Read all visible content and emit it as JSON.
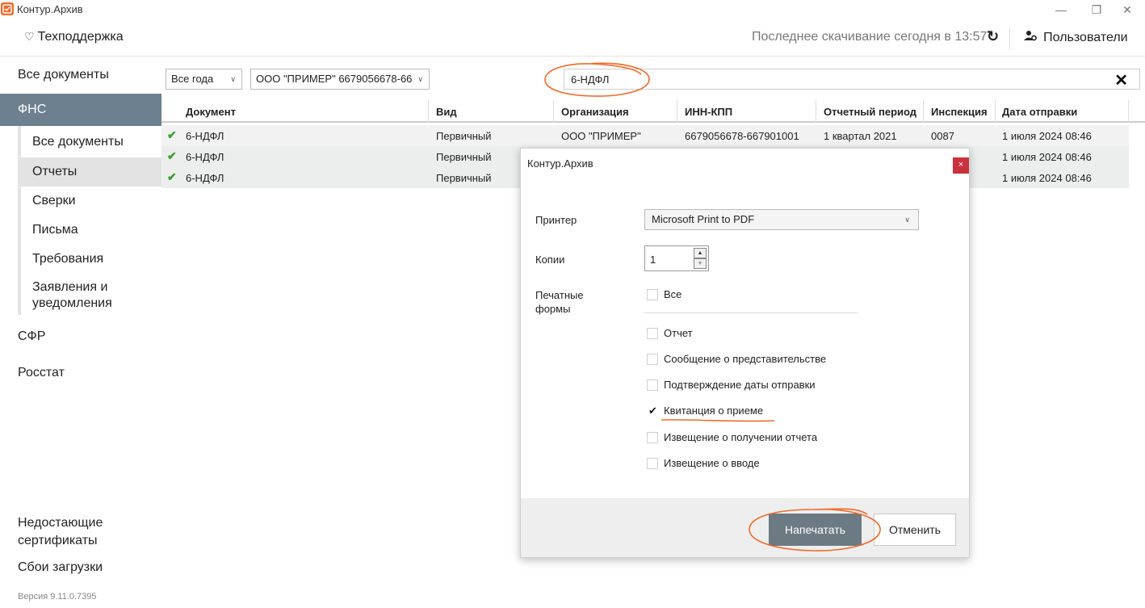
{
  "window": {
    "title": "Контур.Архив",
    "minimize_glyph": "—",
    "restore_glyph": "❐",
    "close_glyph": "✕"
  },
  "header": {
    "support_label": "Техподдержка",
    "last_download": "Последнее скачивание сегодня в 13:57",
    "users_label": "Пользователи"
  },
  "sidebar": {
    "all_documents": "Все документы",
    "fns": "ФНС",
    "fns_items": [
      "Все документы",
      "Отчеты",
      "Сверки",
      "Письма",
      "Требования",
      "Заявления и уведомления"
    ],
    "selected_item": "Отчеты",
    "sfr": "СФР",
    "rosstat": "Росстат",
    "missing_certs": "Недостающие сертификаты",
    "load_errors": "Сбои загрузки",
    "version": "Версия 9.11.0.7395"
  },
  "filters": {
    "year": "Все года",
    "organization": "ООО \"ПРИМЕР\" 6679056678-66",
    "search": "6-НДФЛ"
  },
  "table": {
    "columns": [
      "Документ",
      "Вид",
      "Организация",
      "ИНН-КПП",
      "Отчетный период",
      "Инспекция",
      "Дата отправки"
    ],
    "rows": [
      {
        "document": "6-НДФЛ",
        "kind": "Первичный",
        "org": "ООО \"ПРИМЕР\"",
        "inn": "6679056678-667901001",
        "period": "1 квартал 2021",
        "inspection": "0087",
        "date": "1 июля 2024 08:46"
      },
      {
        "document": "6-НДФЛ",
        "kind": "Первичный",
        "date": "1 июля 2024 08:46"
      },
      {
        "document": "6-НДФЛ",
        "kind": "Первичный",
        "date": "1 июля 2024 08:46"
      }
    ]
  },
  "dialog": {
    "title": "Контур.Архив",
    "close_glyph": "×",
    "printer_label": "Принтер",
    "printer_value": "Microsoft Print to PDF",
    "copies_label": "Копии",
    "copies_value": "1",
    "forms_label": "Печатные формы",
    "forms": [
      {
        "label": "Все",
        "checked": false
      },
      {
        "label": "Отчет",
        "checked": false
      },
      {
        "label": "Сообщение о представительстве",
        "checked": false
      },
      {
        "label": "Подтверждение даты отправки",
        "checked": false
      },
      {
        "label": "Квитанция о приеме",
        "checked": true
      },
      {
        "label": "Извещение о получении отчета",
        "checked": false
      },
      {
        "label": "Извещение о вводе",
        "checked": false
      }
    ],
    "print_button": "Напечатать",
    "cancel_button": "Отменить"
  },
  "colors": {
    "sidebar_selected": "#6c8090",
    "annotation": "#f06a28",
    "check": "#3a9c2e",
    "dialog_close": "#c9323d"
  }
}
